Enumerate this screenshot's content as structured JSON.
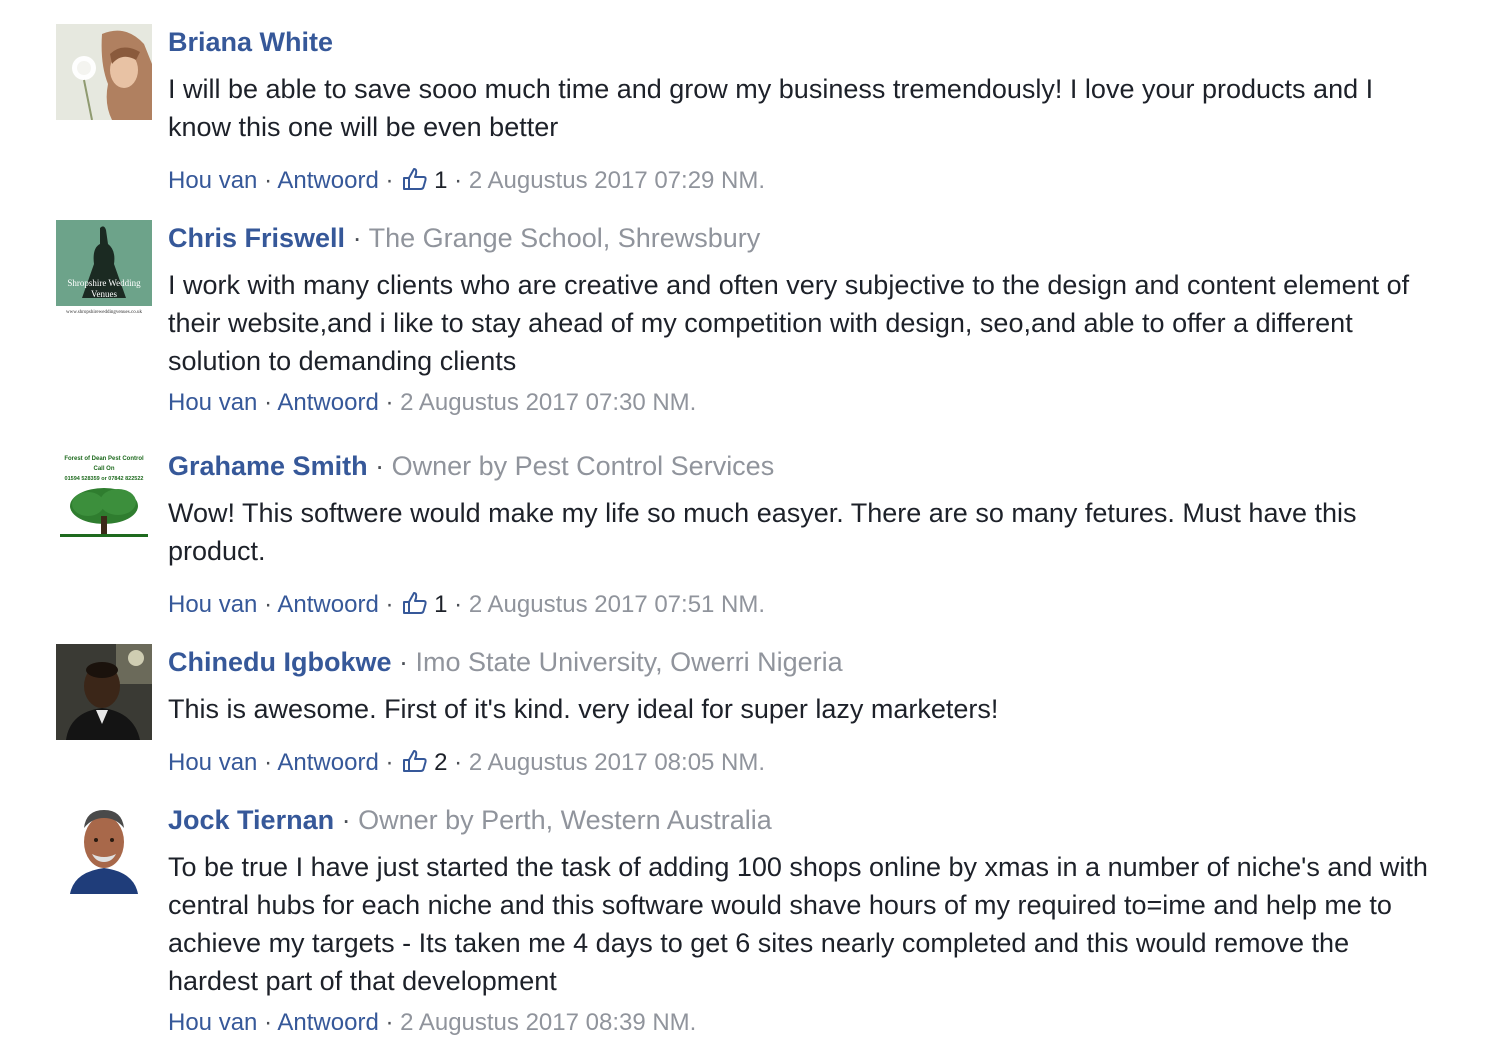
{
  "comments": [
    {
      "author": "Briana White",
      "org": "",
      "text": "I will be able to save sooo much time and grow my business tremendously! I love your products and I know this one will be even better",
      "reply_label": "Hou van",
      "answer_label": "Antwoord",
      "likes": "1",
      "timestamp": "2 Augustus 2017 07:29 NM."
    },
    {
      "author": "Chris Friswell",
      "org": "The Grange School, Shrewsbury",
      "text": "I work with many clients who are creative and often very subjective to the design and content element of their website,and i like to stay ahead of my competition with design, seo,and able to offer a different solution to demanding clients",
      "reply_label": "Hou van",
      "answer_label": "Antwoord",
      "likes": "",
      "timestamp": "2 Augustus 2017 07:30 NM.",
      "avatar_text": [
        "Shropshire Wedding",
        "Venues",
        "www.shropshireweddingvenues.co.uk"
      ]
    },
    {
      "author": "Grahame Smith",
      "org": "Owner by Pest Control Services",
      "text": "Wow! This softwere would make my life so much easyer. There are so many fetures. Must have this product.",
      "reply_label": "Hou van",
      "answer_label": "Antwoord",
      "likes": "1",
      "timestamp": "2 Augustus 2017 07:51 NM.",
      "avatar_text": [
        "Forest of Dean Pest Control",
        "Call On",
        "01594 528359 or 07842 822522"
      ]
    },
    {
      "author": "Chinedu Igbokwe",
      "org": "Imo State University, Owerri Nigeria",
      "text": "This is awesome. First of it's kind. very ideal for super lazy marketers!",
      "reply_label": "Hou van",
      "answer_label": "Antwoord",
      "likes": "2",
      "timestamp": "2 Augustus 2017 08:05 NM."
    },
    {
      "author": "Jock Tiernan",
      "org": "Owner by Perth, Western Australia",
      "text": "To be true I have just started the task of adding 100 shops online by xmas in a number of niche's and with central hubs for each niche and this software would shave hours of my required to=ime and help me to achieve my targets - Its taken me 4 days to get 6 sites nearly completed and this would remove the hardest part of that development",
      "reply_label": "Hou van",
      "answer_label": "Antwoord",
      "likes": "",
      "timestamp": "2 Augustus 2017 08:39 NM."
    }
  ],
  "colors": {
    "link": "#365899",
    "secondary": "#90949c",
    "text": "#1d2129"
  },
  "icons": {
    "like": "thumbs-up-icon"
  }
}
